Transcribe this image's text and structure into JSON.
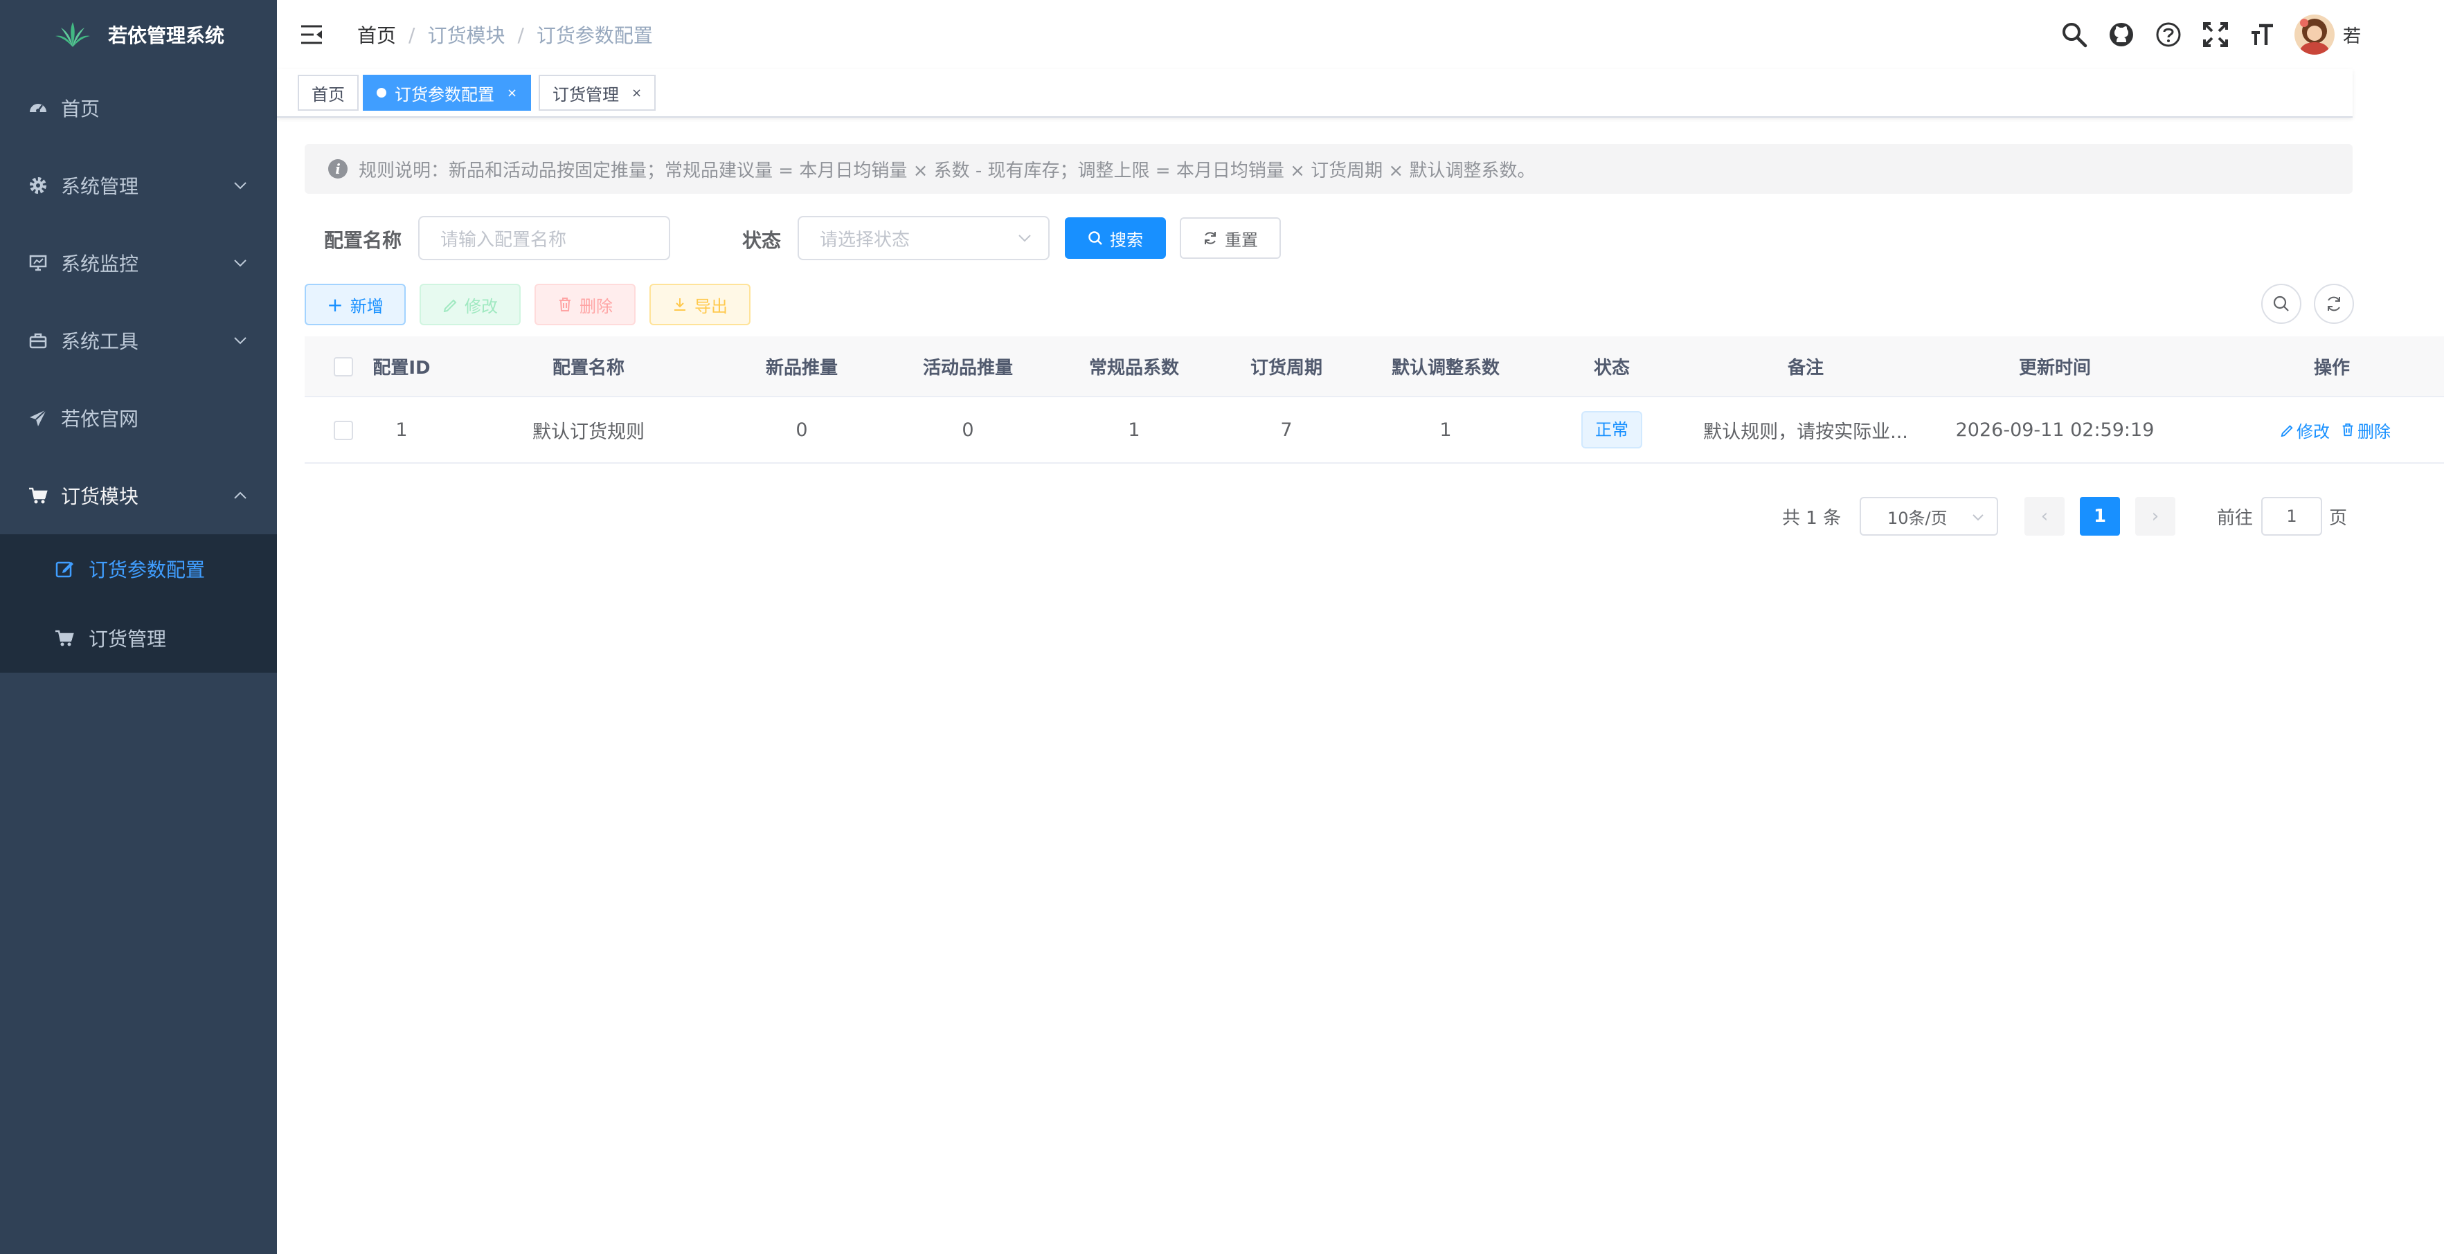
{
  "app": {
    "title": "若依管理系统"
  },
  "sidebar": {
    "items": [
      {
        "label": "首页",
        "icon": "dashboard-icon"
      },
      {
        "label": "系统管理",
        "icon": "gear-icon"
      },
      {
        "label": "系统监控",
        "icon": "monitor-icon"
      },
      {
        "label": "系统工具",
        "icon": "toolbox-icon"
      },
      {
        "label": "若依官网",
        "icon": "paper-plane-icon"
      },
      {
        "label": "订货模块",
        "icon": "cart-icon"
      }
    ],
    "submenu": [
      {
        "label": "订货参数配置",
        "icon": "edit-icon",
        "active": true
      },
      {
        "label": "订货管理",
        "icon": "cart-icon",
        "active": false
      }
    ]
  },
  "navbar": {
    "breadcrumb": [
      "首页",
      "订货模块",
      "订货参数配置"
    ],
    "user_name": "若"
  },
  "tags": [
    {
      "label": "首页",
      "active": false
    },
    {
      "label": "订货参数配置",
      "active": true,
      "close": "×"
    },
    {
      "label": "订货管理",
      "active": false,
      "close": "×"
    }
  ],
  "alert": {
    "icon_text": "i",
    "text": "规则说明：新品和活动品按固定推量；常规品建议量 = 本月日均销量 × 系数 - 现有库存；调整上限 = 本月日均销量 × 订货周期 × 默认调整系数。"
  },
  "search": {
    "name_label": "配置名称",
    "name_placeholder": "请输入配置名称",
    "status_label": "状态",
    "status_placeholder": "请选择状态",
    "search_button": "搜索",
    "reset_button": "重置"
  },
  "toolbar": {
    "add": "新增",
    "edit": "修改",
    "delete": "删除",
    "export": "导出"
  },
  "table": {
    "columns": [
      "配置ID",
      "配置名称",
      "新品推量",
      "活动品推量",
      "常规品系数",
      "订货周期",
      "默认调整系数",
      "状态",
      "备注",
      "更新时间",
      "操作"
    ],
    "rows": [
      {
        "id": "1",
        "name": "默认订货规则",
        "new_push": "0",
        "promo_push": "0",
        "regular_coef": "1",
        "cycle": "7",
        "default_coef": "1",
        "status": "正常",
        "remark": "默认规则，请按实际业...",
        "updated": "2026-09-11 02:59:19",
        "edit": "修改",
        "delete": "删除"
      }
    ]
  },
  "pagination": {
    "total": "共 1 条",
    "page_size": "10条/页",
    "current": "1",
    "prev": "‹",
    "next": "›",
    "goto_label": "前往",
    "goto_value": "1",
    "page_suffix": "页"
  },
  "colors": {
    "sidebar_bg": "#304156",
    "submenu_bg": "#1f2d3d",
    "primary": "#1890ff",
    "active_tag": "#409eff"
  }
}
